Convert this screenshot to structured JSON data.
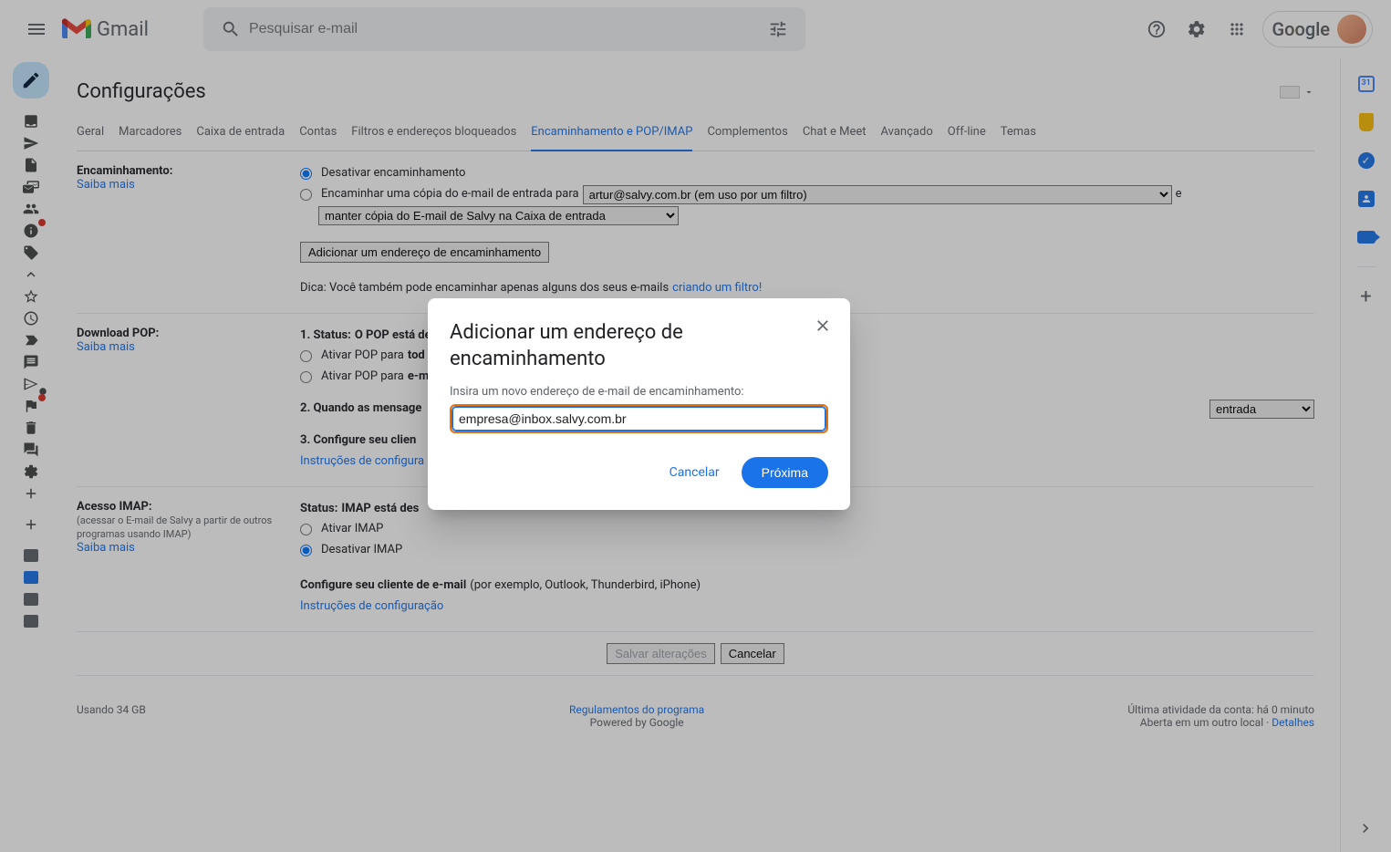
{
  "header": {
    "app_name": "Gmail",
    "search_placeholder": "Pesquisar e-mail",
    "google_label": "Google"
  },
  "settings": {
    "title": "Configurações",
    "tabs": [
      {
        "label": "Geral"
      },
      {
        "label": "Marcadores"
      },
      {
        "label": "Caixa de entrada"
      },
      {
        "label": "Contas"
      },
      {
        "label": "Filtros e endereços bloqueados"
      },
      {
        "label": "Encaminhamento e POP/IMAP",
        "active": true
      },
      {
        "label": "Complementos"
      },
      {
        "label": "Chat e Meet"
      },
      {
        "label": "Avançado"
      },
      {
        "label": "Off-line"
      },
      {
        "label": "Temas"
      }
    ]
  },
  "forwarding": {
    "label": "Encaminhamento:",
    "learn_more": "Saiba mais",
    "disable": "Desativar encaminhamento",
    "forward_copy_prefix": "Encaminhar uma cópia do e-mail de entrada para",
    "forward_dest": "artur@salvy.com.br (em uso por um filtro)",
    "and": "e",
    "keep_copy": "manter cópia do E-mail de Salvy na Caixa de entrada",
    "add_address_btn": "Adicionar um endereço de encaminhamento",
    "tip_prefix": "Dica: Você também pode encaminhar apenas alguns dos seus e-mails ",
    "tip_link": "criando um filtro!"
  },
  "pop": {
    "label": "Download POP:",
    "learn_more": "Saiba mais",
    "status_prefix": "1. Status: ",
    "status_value": "O POP está desativado",
    "enable_all_prefix": "Ativar POP para ",
    "enable_all_bold": "tod",
    "enable_new_prefix": "Ativar POP para ",
    "enable_new_bold": "e-m",
    "when_messages": "2. Quando as mensage",
    "when_sel": "entrada",
    "configure_client": "3. Configure seu clien",
    "config_instructions": "Instruções de configura"
  },
  "imap": {
    "label": "Acesso IMAP:",
    "sub": "(acessar o E-mail de Salvy a partir de outros programas usando IMAP)",
    "learn_more": "Saiba mais",
    "status_prefix": "Status: ",
    "status_value": "IMAP está des",
    "enable": "Ativar IMAP",
    "disable": "Desativar IMAP",
    "configure_bold": "Configure seu cliente de e-mail ",
    "configure_tail": "(por exemplo, Outlook, Thunderbird, iPhone)",
    "config_instructions": "Instruções de configuração"
  },
  "footer_btns": {
    "save": "Salvar alterações",
    "cancel": "Cancelar"
  },
  "footer": {
    "usage": "Usando 34 GB",
    "program": "Regulamentos do programa",
    "powered": "Powered by Google",
    "activity": "Última atividade da conta: há 0 minuto",
    "open_elsewhere": "Aberta em um outro local",
    "details_sep": " · ",
    "details": "Detalhes"
  },
  "modal": {
    "title": "Adicionar um endereço de encaminhamento",
    "label": "Insira um novo endereço de e-mail de encaminhamento:",
    "value": "empresa@inbox.salvy.com.br",
    "cancel": "Cancelar",
    "next": "Próxima"
  }
}
